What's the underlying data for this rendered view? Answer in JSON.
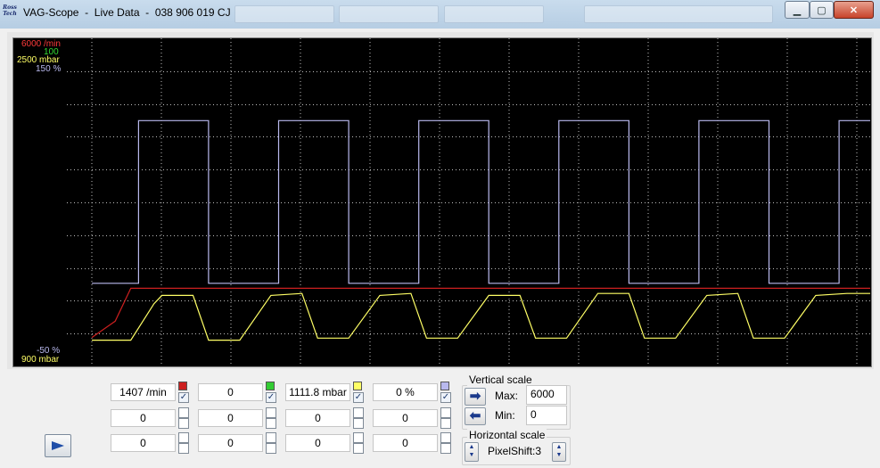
{
  "window": {
    "logo_line1": "Ross",
    "logo_line2": "Tech",
    "title": "VAG-Scope  -  Live Data  -  038 906 019 CJ",
    "minimize_icon": "minimize-icon",
    "maximize_icon": "maximize-icon",
    "close_icon": "close-icon"
  },
  "colors": {
    "ch1": "#cc1f1f",
    "ch2": "#33cc33",
    "ch3": "#ffff66",
    "ch4": "#b9b9ee",
    "grid": "#bfbfbf",
    "plot_bg": "#000000"
  },
  "plot": {
    "top_labels": [
      "6000 /min",
      "100",
      "2500 mbar",
      "150 %"
    ],
    "bottom_labels": [
      "-50 %",
      "900 mbar"
    ]
  },
  "chart_data": {
    "type": "line",
    "xlabel": "",
    "ylabel": "",
    "grid": true,
    "series": [
      {
        "unit": "%",
        "range": [
          -50,
          150
        ],
        "x_frac": [
          0.0,
          0.06,
          0.06,
          0.065,
          0.065,
          0.15,
          0.15,
          0.155,
          0.155,
          0.24,
          0.24,
          0.245,
          0.245,
          0.33,
          0.33,
          0.335,
          0.335,
          0.42,
          0.42,
          0.425,
          0.425,
          0.51,
          0.51,
          0.515,
          0.515,
          0.6,
          0.6,
          0.605,
          0.605,
          0.69,
          0.69,
          0.695,
          0.695,
          0.78,
          0.78,
          0.785,
          0.785,
          0.87,
          0.87,
          0.875,
          0.875,
          0.96,
          0.96,
          1.0
        ],
        "values": [
          0,
          0,
          100,
          100,
          100,
          100,
          0,
          0,
          0,
          0,
          100,
          100,
          100,
          100,
          0,
          0,
          0,
          0,
          100,
          100,
          100,
          100,
          0,
          0,
          0,
          0,
          100,
          100,
          100,
          100,
          0,
          0,
          0,
          0,
          100,
          100,
          100,
          100,
          0,
          0,
          0,
          0,
          100,
          100
        ]
      },
      {
        "unit": "/min",
        "range": [
          0,
          6000
        ],
        "x_frac": [
          0.0,
          0.02,
          0.03,
          0.05,
          1.0
        ],
        "values": [
          500,
          700,
          800,
          1407,
          1407
        ]
      },
      {
        "unit": "mbar",
        "range": [
          900,
          2500
        ],
        "x_frac": [
          0.0,
          0.05,
          0.08,
          0.09,
          0.13,
          0.15,
          0.19,
          0.23,
          0.27,
          0.29,
          0.33,
          0.37,
          0.41,
          0.43,
          0.47,
          0.51,
          0.55,
          0.57,
          0.61,
          0.65,
          0.69,
          0.71,
          0.75,
          0.79,
          0.83,
          0.85,
          0.89,
          0.93,
          0.97,
          1.0
        ],
        "values": [
          1020,
          1020,
          1200,
          1240,
          1240,
          1020,
          1020,
          1240,
          1250,
          1030,
          1030,
          1240,
          1250,
          1030,
          1030,
          1240,
          1240,
          1030,
          1030,
          1250,
          1250,
          1030,
          1030,
          1240,
          1250,
          1030,
          1030,
          1240,
          1250,
          1250
        ]
      }
    ]
  },
  "channels": {
    "rows": [
      [
        "1407 /min",
        "0",
        "1111.8 mbar",
        "0 %"
      ],
      [
        "0",
        "0",
        "0",
        "0"
      ],
      [
        "0",
        "0",
        "0",
        "0"
      ]
    ],
    "checked_mark": "✓"
  },
  "vertical_scale": {
    "title": "Vertical scale",
    "max_label": "Max:",
    "max_value": "6000",
    "min_label": "Min:",
    "min_value": "0",
    "right_arrow": "right-arrow-icon",
    "left_arrow": "left-arrow-icon"
  },
  "horizontal_scale": {
    "title": "Horizontal scale",
    "value": "PixelShift:3",
    "spin_icon": "up-down-spin-icon"
  },
  "play_icon": "play-icon"
}
